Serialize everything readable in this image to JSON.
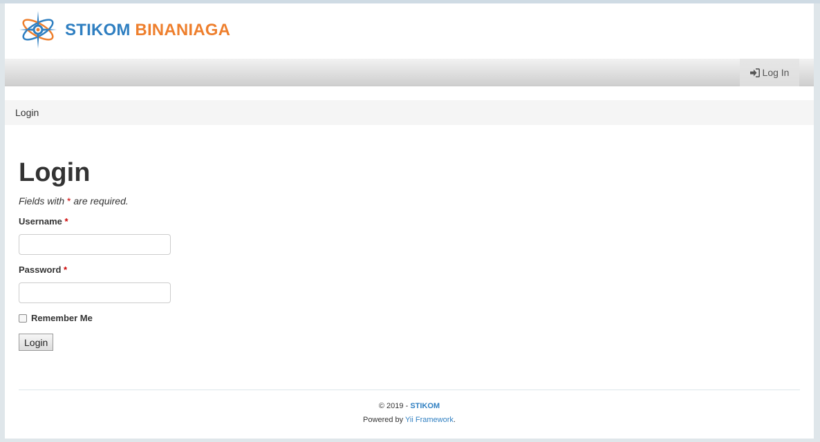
{
  "brand": {
    "part1": "STIKOM",
    "part2": "BINANIAGA",
    "logo_icon": "atom-orbit-icon"
  },
  "navbar": {
    "login_label": "Log In",
    "login_icon": "sign-in-icon"
  },
  "breadcrumb": {
    "current": "Login"
  },
  "form": {
    "title": "Login",
    "note_prefix": "Fields with",
    "note_star": "*",
    "note_suffix": "are required.",
    "username_label": "Username",
    "username_value": "",
    "password_label": "Password",
    "password_value": "",
    "required_mark": "*",
    "remember_label": "Remember Me",
    "remember_checked": false,
    "submit_label": "Login"
  },
  "footer": {
    "copyright_prefix": "© 2019 -",
    "copyright_brand": "STIKOM",
    "powered_prefix": "Powered by",
    "powered_link": "Yii Framework",
    "powered_suffix": "."
  },
  "colors": {
    "brand_blue": "#2f7fc1",
    "brand_orange": "#ee7f2d",
    "required_red": "#cc0000"
  }
}
